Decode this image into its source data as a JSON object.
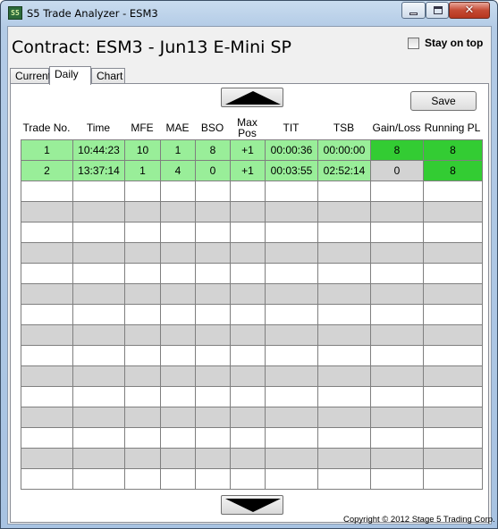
{
  "window": {
    "title": "S5 Trade Analyzer - ESM3",
    "icon_text": "S5",
    "icon": "app-icon"
  },
  "title_controls": {
    "minimize": "minimize-icon",
    "maximize": "maximize-icon",
    "close_glyph": "✕"
  },
  "header": {
    "contract_title": "Contract: ESM3 - Jun13 E-Mini SP",
    "stay_on_top_label": "Stay on top",
    "stay_on_top_checked": false
  },
  "tabs": [
    {
      "label": "Current",
      "active": false
    },
    {
      "label": "Daily",
      "active": true
    },
    {
      "label": "Chart",
      "active": false
    }
  ],
  "toolbar": {
    "save_label": "Save",
    "scroll_up_icon": "triangle-up-icon",
    "scroll_down_icon": "triangle-down-icon"
  },
  "columns": [
    "Trade No.",
    "Time",
    "MFE",
    "MAE",
    "BSO",
    "Max\nPos",
    "TIT",
    "TSB",
    "Gain/Loss",
    "Running PL"
  ],
  "rows": [
    {
      "trade_no": "1",
      "time": "10:44:23",
      "mfe": "10",
      "mae": "1",
      "bso": "8",
      "max_pos": "+1",
      "tit": "00:00:36",
      "tsb": "00:00:00",
      "gain_loss": "8",
      "running_pl": "8"
    },
    {
      "trade_no": "2",
      "time": "13:37:14",
      "mfe": "1",
      "mae": "4",
      "bso": "0",
      "max_pos": "+1",
      "tit": "00:03:55",
      "tsb": "02:52:14",
      "gain_loss": "0",
      "running_pl": "8"
    }
  ],
  "colors": {
    "row_green": "#99ee99",
    "pl_positive": "#33cc33",
    "pl_zero": "#d3d3d3",
    "row_alt_gray": "#d3d3d3"
  },
  "footer": {
    "copyright": "Copyright © 2012 Stage 5 Trading Corp."
  }
}
